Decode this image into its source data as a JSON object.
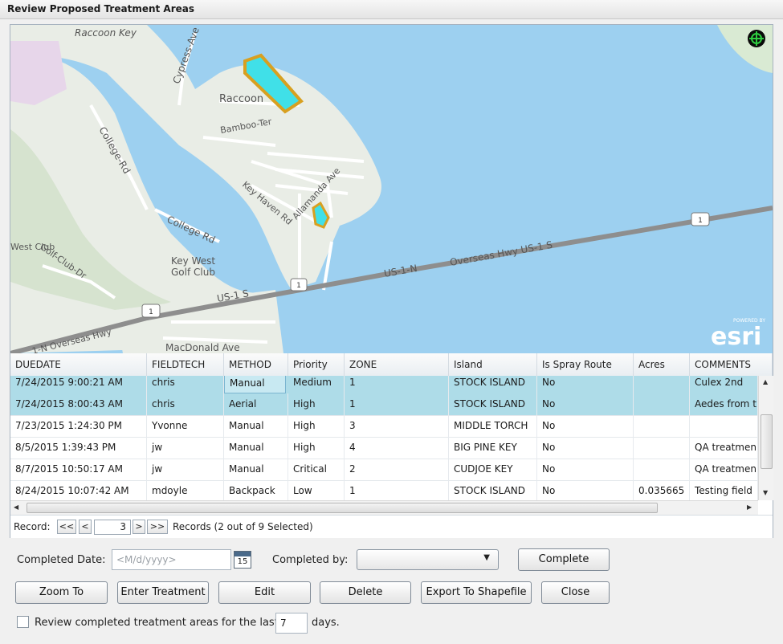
{
  "window": {
    "title": "Review Proposed Treatment Areas"
  },
  "map": {
    "labels": {
      "raccoon_key": "Raccoon Key",
      "cypress_ave": "Cypress-Ave",
      "raccoon": "Raccoon",
      "bamboo_ter": "Bamboo-Ter",
      "college_rd_1": "College-Rd",
      "college_rd_2": "College Rd",
      "key_haven_rd": "Key Haven Rd",
      "allamanda_ave": "Allamanda Ave",
      "west_club": "West Club",
      "golf_club_dr": "Golf-Club-Dr",
      "key_west": "Key West",
      "golf_club": "Golf Club",
      "us1n_1": "US-1-N",
      "us1s_1": "US-1 S",
      "overseas_1": "Overseas Hwy US-1 S",
      "overseas_2": "1-N Overseas Hwy",
      "macdonald_ave": "MacDonald Ave",
      "shield_1": "1",
      "shield_2": "1",
      "shield_3": "1"
    },
    "esri": {
      "powered_by": "POWERED BY",
      "logo": "esri"
    },
    "colors": {
      "water": "#9dd0f0",
      "land": "#e9ede6",
      "polygon_fill": "#40e0e8",
      "polygon_stroke": "#d8a020"
    }
  },
  "grid": {
    "columns": [
      "DUEDATE",
      "FIELDTECH",
      "METHOD",
      "Priority",
      "ZONE",
      "Island",
      "Is Spray Route",
      "Acres",
      "COMMENTS"
    ],
    "rows": [
      {
        "duedate": "7/24/2015 9:00:21 AM",
        "fieldtech": "chris",
        "method": "Manual",
        "priority": "Medium",
        "zone": "1",
        "island": "STOCK ISLAND",
        "spray": "No",
        "acres": "",
        "comments": "Culex 2nd",
        "selected": true
      },
      {
        "duedate": "7/24/2015 8:00:43 AM",
        "fieldtech": "chris",
        "method": "Aerial",
        "priority": "High",
        "zone": "1",
        "island": "STOCK ISLAND",
        "spray": "No",
        "acres": "",
        "comments": "Aedes from t",
        "selected": true
      },
      {
        "duedate": "7/23/2015 1:24:30 PM",
        "fieldtech": "Yvonne",
        "method": "Manual",
        "priority": "High",
        "zone": "3",
        "island": "MIDDLE TORCH",
        "spray": "No",
        "acres": "",
        "comments": "",
        "selected": false
      },
      {
        "duedate": "8/5/2015 1:39:43 PM",
        "fieldtech": "jw",
        "method": "Manual",
        "priority": "High",
        "zone": "4",
        "island": "BIG PINE KEY",
        "spray": "No",
        "acres": "",
        "comments": "QA treatmen",
        "selected": false
      },
      {
        "duedate": "8/7/2015 10:50:17 AM",
        "fieldtech": "jw",
        "method": "Manual",
        "priority": "Critical",
        "zone": "2",
        "island": "CUDJOE KEY",
        "spray": "No",
        "acres": "",
        "comments": "QA treatmen",
        "selected": false
      },
      {
        "duedate": "8/24/2015 10:07:42 AM",
        "fieldtech": "mdoyle",
        "method": "Backpack",
        "priority": "Low",
        "zone": "1",
        "island": "STOCK ISLAND",
        "spray": "No",
        "acres": "0.035665",
        "comments": "Testing field",
        "selected": false
      }
    ]
  },
  "pager": {
    "record_label": "Record:",
    "first": "<<",
    "prev": "<",
    "current": "3",
    "next": ">",
    "last": ">>",
    "summary": "Records (2 out of 9 Selected)"
  },
  "form": {
    "completed_date_label": "Completed Date:",
    "completed_date_placeholder": "<M/d/yyyy>",
    "calendar_day": "15",
    "completed_by_label": "Completed by:",
    "completed_by_value": "",
    "complete_button": "Complete"
  },
  "actions": {
    "zoom_to": "Zoom To",
    "enter_treatment": "Enter Treatment",
    "edit": "Edit",
    "delete": "Delete",
    "export": "Export To Shapefile",
    "close": "Close"
  },
  "review": {
    "checkbox_label": "Review completed treatment areas for the last",
    "days_value": "7",
    "days_label": "days."
  }
}
